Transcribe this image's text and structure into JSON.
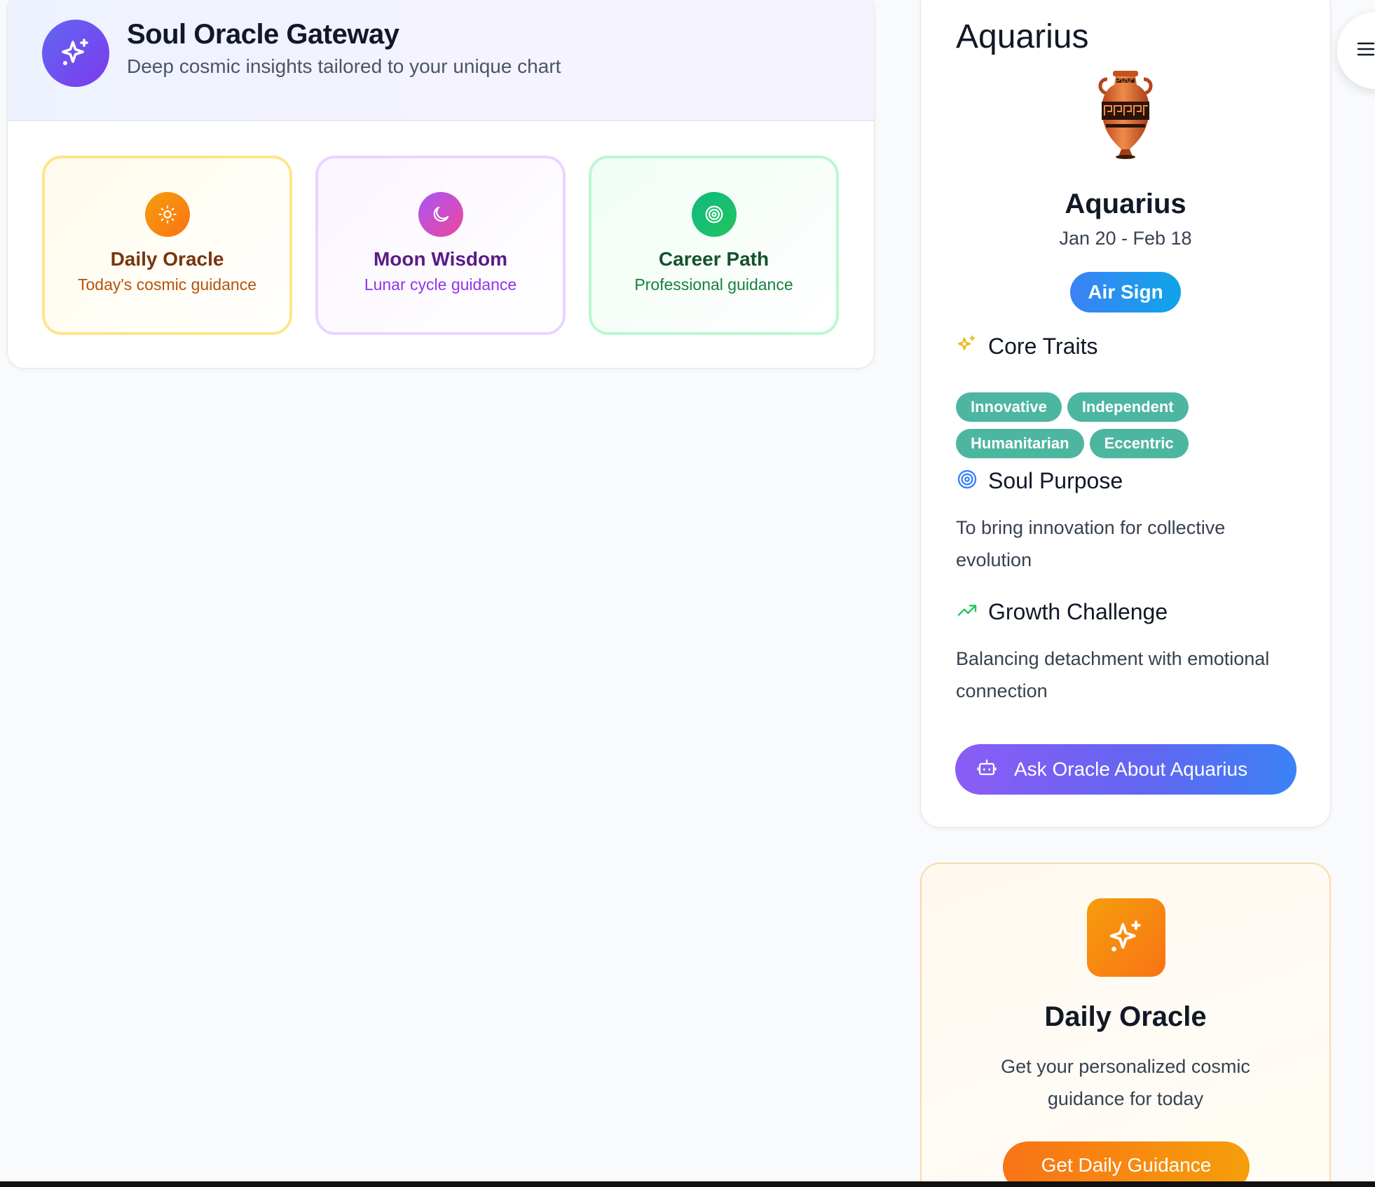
{
  "gateway": {
    "title": "Soul Oracle Gateway",
    "subtitle": "Deep cosmic insights tailored to your unique chart",
    "icon": "sparkles-icon",
    "tiles": [
      {
        "title": "Daily Oracle",
        "subtitle": "Today's cosmic guidance",
        "icon": "sun-icon",
        "color": "#f59e0b"
      },
      {
        "title": "Moon Wisdom",
        "subtitle": "Lunar cycle guidance",
        "icon": "moon-icon",
        "color": "#a855f7"
      },
      {
        "title": "Career Path",
        "subtitle": "Professional guidance",
        "icon": "target-icon",
        "color": "#10b981"
      }
    ]
  },
  "sign": {
    "heading": "Aquarius",
    "emoji": "amphora-icon",
    "name": "Aquarius",
    "dates": "Jan 20 - Feb 18",
    "element": "Air Sign",
    "core_traits_label": "Core Traits",
    "traits": [
      "Innovative",
      "Independent",
      "Humanitarian",
      "Eccentric"
    ],
    "soul_purpose_label": "Soul Purpose",
    "soul_purpose": "To bring innovation for collective evolution",
    "growth_label": "Growth Challenge",
    "growth": "Balancing detachment with emotional connection",
    "ask_button": "Ask Oracle About Aquarius"
  },
  "daily_oracle": {
    "title": "Daily Oracle",
    "text": "Get your personalized cosmic guidance for today",
    "button": "Get Daily Guidance",
    "icon": "sparkles-icon"
  },
  "menu": {
    "icon": "hamburger-menu-icon"
  },
  "colors": {
    "primary": "#6366f1",
    "trait_badge": "#4db6a1",
    "air_sign": "#3b82f6",
    "daily_accent": "#f59e0b"
  }
}
